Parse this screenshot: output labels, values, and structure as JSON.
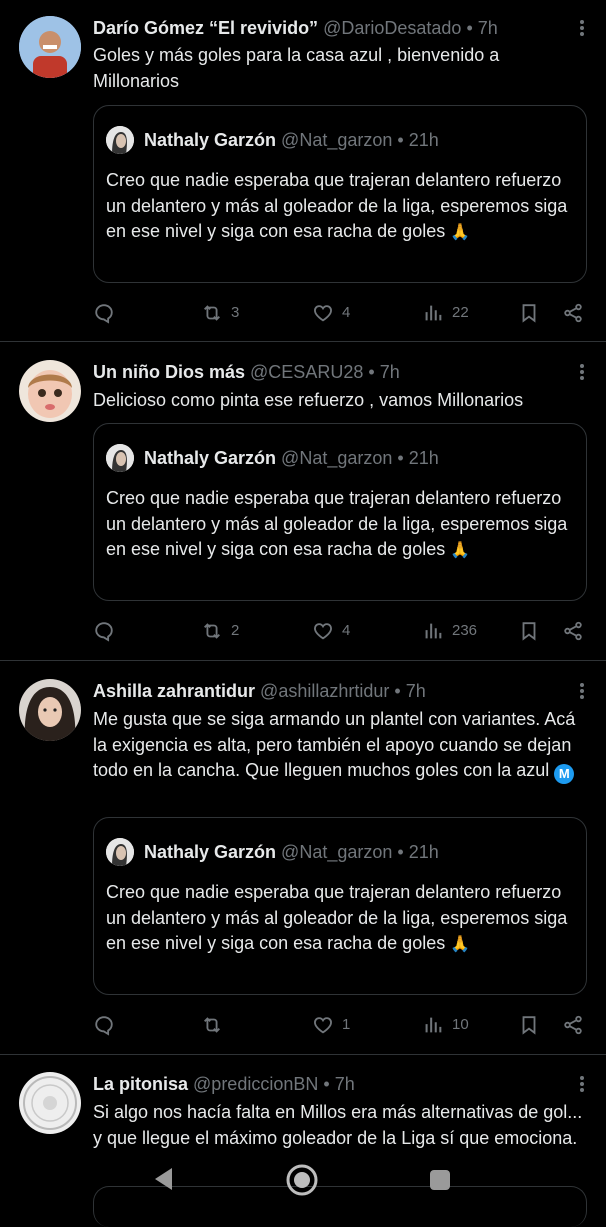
{
  "tweets": [
    {
      "name": "Darío Gómez “El revivido”",
      "handle": "@DarioDesatado",
      "time": "7h",
      "text": "Goles y más goles para la casa azul , bienvenido a Millonarios",
      "quote": {
        "name": "Nathaly Garzón",
        "handle": "@Nat_garzon",
        "time": "21h",
        "text": "Creo que nadie esperaba que trajeran delantero refuerzo un delantero y más al goleador de la liga, esperemos siga en ese nivel y siga con esa racha de goles",
        "emoji": "🙏"
      },
      "replies": "",
      "retweets": "3",
      "likes": "4",
      "views": "22"
    },
    {
      "name": "Un niño Dios más",
      "handle": "@CESARU28",
      "time": "7h",
      "text": "Delicioso como pinta ese refuerzo , vamos Millonarios",
      "quote": {
        "name": "Nathaly Garzón",
        "handle": "@Nat_garzon",
        "time": "21h",
        "text": "Creo que nadie esperaba que trajeran delantero refuerzo un delantero y más al goleador de la liga, esperemos siga en ese nivel y siga con esa racha de goles",
        "emoji": "🙏"
      },
      "replies": "",
      "retweets": "2",
      "likes": "4",
      "views": "236"
    },
    {
      "name": "Ashilla zahrantidur",
      "handle": "@ashillazhrtidur",
      "time": "7h",
      "text": "Me gusta que se siga armando un plantel con variantes. Acá la exigencia es alta, pero también el apoyo cuando se dejan todo en la cancha. Que lleguen muchos goles con la azul",
      "badge": "M",
      "quote": {
        "name": "Nathaly Garzón",
        "handle": "@Nat_garzon",
        "time": "21h",
        "text": "Creo que nadie esperaba que trajeran delantero refuerzo un delantero y más al goleador de la liga, esperemos siga en ese nivel y siga con esa racha de goles",
        "emoji": "🙏"
      },
      "replies": "",
      "retweets": "",
      "likes": "1",
      "views": "10"
    },
    {
      "name": "La pitonisa",
      "handle": "@prediccionBN",
      "time": "7h",
      "text": "Si algo nos hacía falta en Millos era más alternativas de gol... y que llegue el máximo goleador de la Liga sí que emociona."
    }
  ],
  "sep": "•",
  "colors": {
    "bg": "#000000",
    "text": "#e7e9ea",
    "muted": "#71767b",
    "border": "#2f3336"
  }
}
